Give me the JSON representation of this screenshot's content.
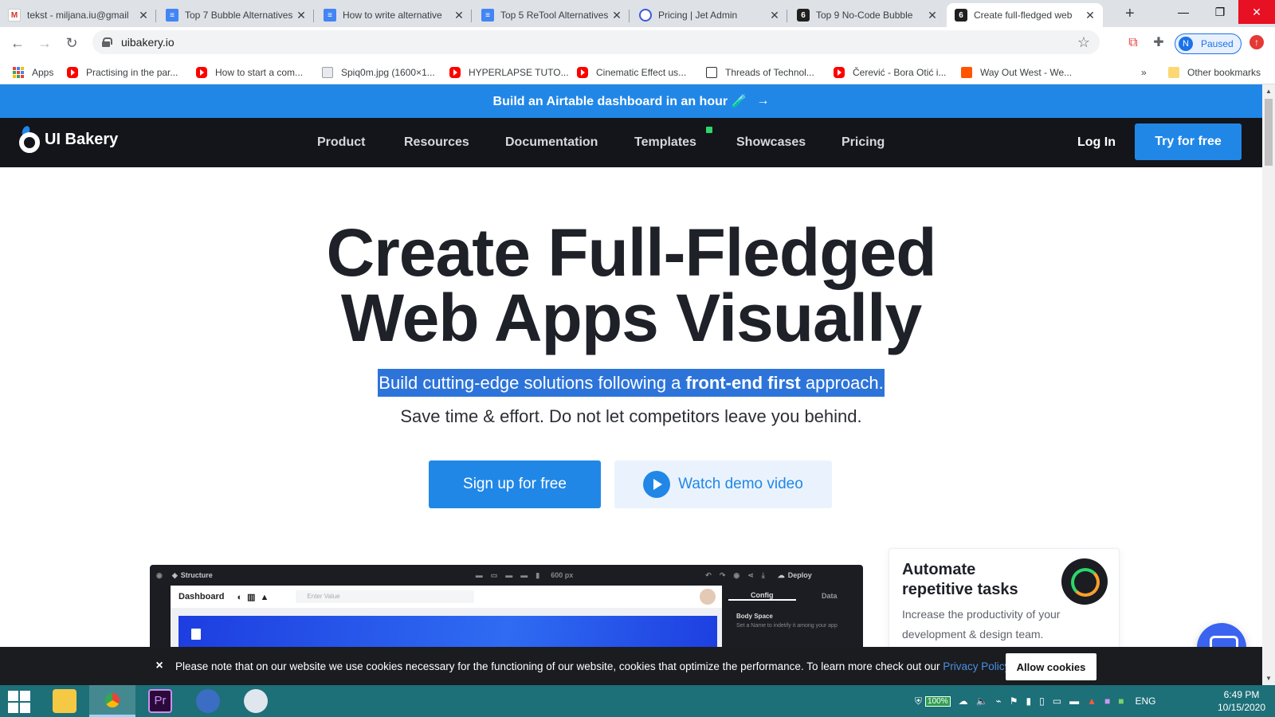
{
  "browser": {
    "tabs": [
      {
        "title": "tekst - miljana.iu@gmail",
        "favicon": "gmail-icon"
      },
      {
        "title": "Top 7 Bubble Alternatives",
        "favicon": "docs-icon"
      },
      {
        "title": "How to write alternative",
        "favicon": "docs-icon"
      },
      {
        "title": "Top 5 ReTool Alternatives",
        "favicon": "docs-icon"
      },
      {
        "title": "Pricing | Jet Admin",
        "favicon": "jetadmin-icon"
      },
      {
        "title": "Top 9 No-Code Bubble",
        "favicon": "uibakery-icon"
      },
      {
        "title": "Create full-fledged web",
        "favicon": "uibakery-icon",
        "active": true
      }
    ],
    "new_tab": "+",
    "url": "uibakery.io",
    "profile": {
      "initial": "N",
      "label": "Paused"
    },
    "bookmarks": [
      {
        "label": "Apps",
        "icon": "apps-grid-icon"
      },
      {
        "label": "Practising in the par...",
        "icon": "youtube-icon"
      },
      {
        "label": "How to start a com...",
        "icon": "youtube-icon"
      },
      {
        "label": "Spiq0m.jpg (1600×1...",
        "icon": "image-icon"
      },
      {
        "label": "HYPERLAPSE TUTO...",
        "icon": "youtube-icon"
      },
      {
        "label": "Cinematic Effect us...",
        "icon": "youtube-icon"
      },
      {
        "label": "Threads of Technol...",
        "icon": "museum-icon"
      },
      {
        "label": "Čerević - Bora Otić i...",
        "icon": "youtube-icon"
      },
      {
        "label": "Way Out West - We...",
        "icon": "soundcloud-icon"
      }
    ],
    "more_bookmarks": "»",
    "other_bookmarks": "Other bookmarks"
  },
  "site": {
    "banner": {
      "text": "Build an Airtable dashboard in an hour 🧪",
      "arrow": "→"
    },
    "logo_text": "UI Bakery",
    "menu": [
      "Product",
      "Resources",
      "Documentation",
      "Templates",
      "Showcases",
      "Pricing"
    ],
    "login": "Log In",
    "cta": "Try for free",
    "hero": {
      "title_line1": "Create Full-Fledged",
      "title_line2": "Web Apps Visually",
      "sub1_pre": "Build cutting-edge solutions following a ",
      "sub1_bold": "front-end first",
      "sub1_post": " approach.",
      "sub2": "Save time & effort. Do not let competitors leave you behind.",
      "signup": "Sign up for free",
      "demo": "Watch demo video"
    },
    "mockup": {
      "structure": "Structure",
      "width_label": "600 px",
      "deploy": "Deploy",
      "dashboard": "Dashboard",
      "search_placeholder": "Enter Value",
      "tab_config": "Config",
      "tab_data": "Data",
      "body_space": "Body Space",
      "body_hint": "Set a Name to indetify it among your app"
    },
    "card": {
      "title": "Automate repetitive tasks",
      "text": "Increase the productivity of your development & design team."
    },
    "cookie": {
      "close": "×",
      "text": "Please note that on our website we use cookies necessary for the functioning of our website, cookies that optimize the performance. To learn more check out our ",
      "link": "Privacy Policy",
      "suffix": ".",
      "button": "Allow cookies"
    }
  },
  "taskbar": {
    "battery": "100%",
    "lang": "ENG",
    "time": "6:49 PM",
    "date": "10/15/2020"
  },
  "colors": {
    "brand_blue": "#2187e7",
    "nav_dark": "#13151a",
    "taskbar": "#1d6f78"
  }
}
